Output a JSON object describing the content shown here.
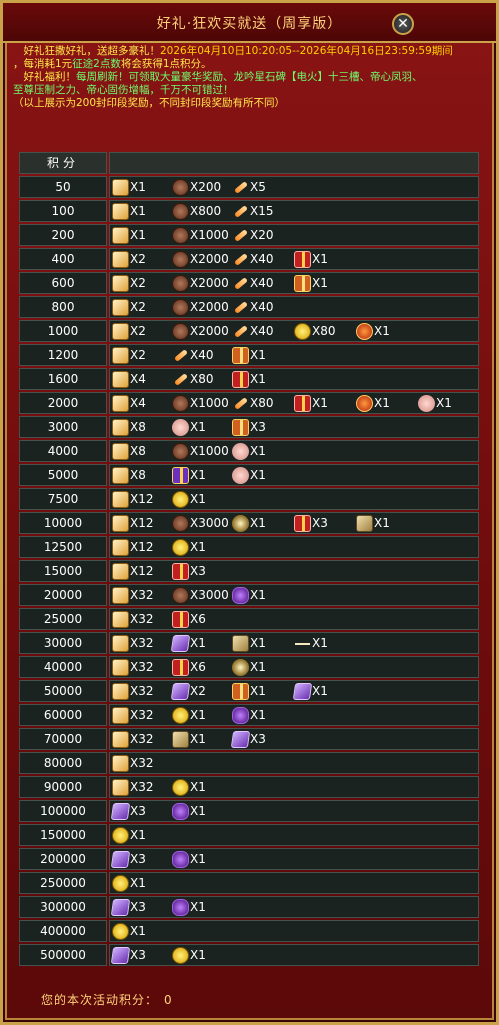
{
  "title": "好礼·狂欢买就送（周享版）",
  "notice": {
    "line1_a": "　好礼狂撒好礼，送超多豪礼！",
    "line1_b": "2026年04月10日10:20:05--2026年04月16日23:59:59期间",
    "line2_a": "，每消耗1元",
    "line2_b": "征途2点数",
    "line2_c": "将会获得1点积分。",
    "line3_a": "　好礼福利！",
    "line3_b": "每周刷新！可领取大量豪华奖励、龙吟星石碑【电火】十三槽、帝心凤羽、",
    "line4": "至尊压制之力、帝心固伤增幅，千万不可错过！",
    "line5": "（以上展示为200封印段奖励，不同封印段奖励有所不同）"
  },
  "table_header": {
    "score_label": "积分"
  },
  "rows": [
    {
      "score": "50",
      "rewards": [
        {
          "icon": "scroll-icon",
          "qty": "X1"
        },
        {
          "icon": "ore-icon",
          "qty": "X200"
        },
        {
          "icon": "feather-icon",
          "qty": "X5"
        }
      ]
    },
    {
      "score": "100",
      "rewards": [
        {
          "icon": "scroll-icon",
          "qty": "X1"
        },
        {
          "icon": "ore-icon",
          "qty": "X800"
        },
        {
          "icon": "feather-icon",
          "qty": "X15"
        }
      ]
    },
    {
      "score": "200",
      "rewards": [
        {
          "icon": "scroll-icon",
          "qty": "X1"
        },
        {
          "icon": "ore-icon",
          "qty": "X1000"
        },
        {
          "icon": "feather-icon",
          "qty": "X20"
        }
      ]
    },
    {
      "score": "400",
      "rewards": [
        {
          "icon": "scroll-icon",
          "qty": "X2"
        },
        {
          "icon": "ore-icon",
          "qty": "X2000"
        },
        {
          "icon": "feather-icon",
          "qty": "X40"
        },
        {
          "icon": "red-gift-icon",
          "qty": "X1"
        }
      ]
    },
    {
      "score": "600",
      "rewards": [
        {
          "icon": "scroll-icon",
          "qty": "X2"
        },
        {
          "icon": "ore-icon",
          "qty": "X2000"
        },
        {
          "icon": "feather-icon",
          "qty": "X40"
        },
        {
          "icon": "gold-gift-icon",
          "qty": "X1"
        }
      ]
    },
    {
      "score": "800",
      "rewards": [
        {
          "icon": "scroll-icon",
          "qty": "X2"
        },
        {
          "icon": "ore-icon",
          "qty": "X2000"
        },
        {
          "icon": "feather-icon",
          "qty": "X40"
        }
      ]
    },
    {
      "score": "1000",
      "rewards": [
        {
          "icon": "scroll-icon",
          "qty": "X2"
        },
        {
          "icon": "ore-icon",
          "qty": "X2000"
        },
        {
          "icon": "feather-icon",
          "qty": "X40"
        },
        {
          "icon": "coin-icon",
          "qty": "X80"
        },
        {
          "icon": "fire-orb-icon",
          "qty": "X1"
        }
      ]
    },
    {
      "score": "1200",
      "rewards": [
        {
          "icon": "scroll-icon",
          "qty": "X2"
        },
        {
          "icon": "feather-icon",
          "qty": "X40"
        },
        {
          "icon": "gold-gift-icon",
          "qty": "X1"
        }
      ]
    },
    {
      "score": "1600",
      "rewards": [
        {
          "icon": "scroll-icon",
          "qty": "X4"
        },
        {
          "icon": "feather-icon",
          "qty": "X80"
        },
        {
          "icon": "red-gift-icon",
          "qty": "X1"
        }
      ]
    },
    {
      "score": "2000",
      "rewards": [
        {
          "icon": "scroll-icon",
          "qty": "X4"
        },
        {
          "icon": "ore-icon",
          "qty": "X1000"
        },
        {
          "icon": "feather-icon",
          "qty": "X80"
        },
        {
          "icon": "red-gift-icon",
          "qty": "X1"
        },
        {
          "icon": "fire-orb-icon",
          "qty": "X1"
        },
        {
          "icon": "brain-icon",
          "qty": "X1"
        }
      ]
    },
    {
      "score": "3000",
      "rewards": [
        {
          "icon": "scroll-icon",
          "qty": "X8"
        },
        {
          "icon": "brain-icon",
          "qty": "X1"
        },
        {
          "icon": "gold-gift-icon",
          "qty": "X3"
        }
      ]
    },
    {
      "score": "4000",
      "rewards": [
        {
          "icon": "scroll-icon",
          "qty": "X8"
        },
        {
          "icon": "ore-icon",
          "qty": "X1000"
        },
        {
          "icon": "brain-icon",
          "qty": "X1"
        }
      ]
    },
    {
      "score": "5000",
      "rewards": [
        {
          "icon": "scroll-icon",
          "qty": "X8"
        },
        {
          "icon": "purple-gift-icon",
          "qty": "X1"
        },
        {
          "icon": "brain-icon",
          "qty": "X1"
        }
      ]
    },
    {
      "score": "7500",
      "rewards": [
        {
          "icon": "scroll-icon",
          "qty": "X12"
        },
        {
          "icon": "coin-icon",
          "qty": "X1"
        }
      ]
    },
    {
      "score": "10000",
      "rewards": [
        {
          "icon": "scroll-icon",
          "qty": "X12"
        },
        {
          "icon": "ore-icon",
          "qty": "X3000"
        },
        {
          "icon": "sparkle-icon",
          "qty": "X1"
        },
        {
          "icon": "red-gift-icon",
          "qty": "X3"
        },
        {
          "icon": "box-icon",
          "qty": "X1"
        }
      ]
    },
    {
      "score": "12500",
      "rewards": [
        {
          "icon": "scroll-icon",
          "qty": "X12"
        },
        {
          "icon": "coin-icon",
          "qty": "X1"
        }
      ]
    },
    {
      "score": "15000",
      "rewards": [
        {
          "icon": "scroll-icon",
          "qty": "X12"
        },
        {
          "icon": "red-gift-icon",
          "qty": "X3"
        }
      ]
    },
    {
      "score": "20000",
      "rewards": [
        {
          "icon": "scroll-icon",
          "qty": "X32"
        },
        {
          "icon": "ore-icon",
          "qty": "X3000"
        },
        {
          "icon": "gem-icon",
          "qty": "X1"
        }
      ]
    },
    {
      "score": "25000",
      "rewards": [
        {
          "icon": "scroll-icon",
          "qty": "X32"
        },
        {
          "icon": "red-gift-icon",
          "qty": "X6"
        }
      ]
    },
    {
      "score": "30000",
      "rewards": [
        {
          "icon": "scroll-icon",
          "qty": "X32"
        },
        {
          "icon": "card-icon",
          "qty": "X1"
        },
        {
          "icon": "box-icon",
          "qty": "X1"
        },
        {
          "icon": "stick-icon",
          "qty": "X1"
        }
      ]
    },
    {
      "score": "40000",
      "rewards": [
        {
          "icon": "scroll-icon",
          "qty": "X32"
        },
        {
          "icon": "red-gift-icon",
          "qty": "X6"
        },
        {
          "icon": "sparkle-icon",
          "qty": "X1"
        }
      ]
    },
    {
      "score": "50000",
      "rewards": [
        {
          "icon": "scroll-icon",
          "qty": "X32"
        },
        {
          "icon": "card-icon",
          "qty": "X2"
        },
        {
          "icon": "gold-gift-icon",
          "qty": "X1"
        },
        {
          "icon": "card-icon",
          "qty": "X1"
        }
      ]
    },
    {
      "score": "60000",
      "rewards": [
        {
          "icon": "scroll-icon",
          "qty": "X32"
        },
        {
          "icon": "coin-icon",
          "qty": "X1"
        },
        {
          "icon": "gem-icon",
          "qty": "X1"
        }
      ]
    },
    {
      "score": "70000",
      "rewards": [
        {
          "icon": "scroll-icon",
          "qty": "X32"
        },
        {
          "icon": "box-icon",
          "qty": "X1"
        },
        {
          "icon": "card-icon",
          "qty": "X3"
        }
      ]
    },
    {
      "score": "80000",
      "rewards": [
        {
          "icon": "scroll-icon",
          "qty": "X32"
        }
      ]
    },
    {
      "score": "90000",
      "rewards": [
        {
          "icon": "scroll-icon",
          "qty": "X32"
        },
        {
          "icon": "coin-icon",
          "qty": "X1"
        }
      ]
    },
    {
      "score": "100000",
      "rewards": [
        {
          "icon": "card-icon",
          "qty": "X3"
        },
        {
          "icon": "gem-icon",
          "qty": "X1"
        }
      ]
    },
    {
      "score": "150000",
      "rewards": [
        {
          "icon": "coin-icon",
          "qty": "X1"
        }
      ]
    },
    {
      "score": "200000",
      "rewards": [
        {
          "icon": "card-icon",
          "qty": "X3"
        },
        {
          "icon": "gem-icon",
          "qty": "X1"
        }
      ]
    },
    {
      "score": "250000",
      "rewards": [
        {
          "icon": "coin-icon",
          "qty": "X1"
        }
      ]
    },
    {
      "score": "300000",
      "rewards": [
        {
          "icon": "card-icon",
          "qty": "X3"
        },
        {
          "icon": "gem-icon",
          "qty": "X1"
        }
      ]
    },
    {
      "score": "400000",
      "rewards": [
        {
          "icon": "coin-icon",
          "qty": "X1"
        }
      ]
    },
    {
      "score": "500000",
      "rewards": [
        {
          "icon": "card-icon",
          "qty": "X3"
        },
        {
          "icon": "coin-icon",
          "qty": "X1"
        }
      ]
    }
  ],
  "footer": {
    "label": "您的本次活动积分：",
    "value": "0"
  },
  "colors": {
    "accent_gold": "#c9a24a",
    "notice_yellow": "#ffe94a",
    "notice_green": "#6dff6d",
    "panel_red": "#8a1414"
  }
}
